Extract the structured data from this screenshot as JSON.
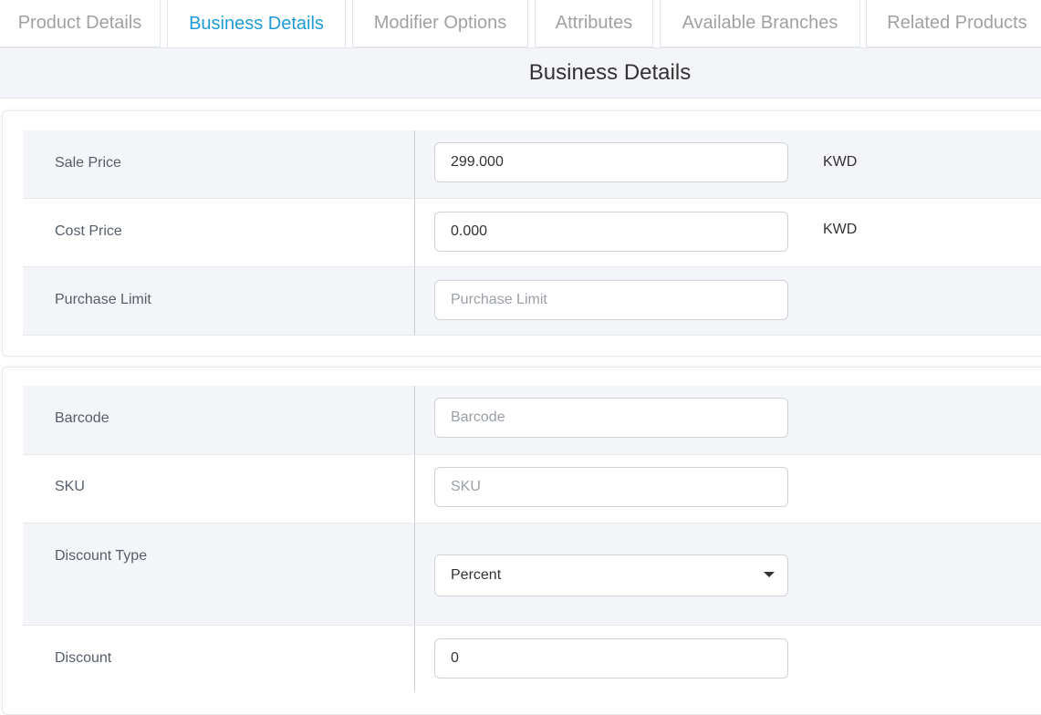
{
  "tabs": [
    {
      "label": "Product Details"
    },
    {
      "label": "Business Details"
    },
    {
      "label": "Modifier Options"
    },
    {
      "label": "Attributes"
    },
    {
      "label": "Available Branches"
    },
    {
      "label": "Related Products"
    }
  ],
  "active_tab": "Business Details",
  "section": {
    "title": "Business Details"
  },
  "card1": {
    "sale_price": {
      "label": "Sale Price",
      "value": "299.000",
      "unit": "KWD"
    },
    "cost_price": {
      "label": "Cost Price",
      "value": "0.000",
      "unit": "KWD"
    },
    "purchase_limit": {
      "label": "Purchase Limit",
      "placeholder": "Purchase Limit"
    }
  },
  "card2": {
    "barcode": {
      "label": "Barcode",
      "placeholder": "Barcode"
    },
    "sku": {
      "label": "SKU",
      "placeholder": "SKU"
    },
    "discount_type": {
      "label": "Discount Type",
      "value": "Percent",
      "icon": "caret-down-icon"
    },
    "discount": {
      "label": "Discount",
      "value": "0"
    }
  },
  "colors": {
    "active_tab": "#1f9ad6",
    "row_shade": "#f4f5f8",
    "border": "#e3e6ea"
  }
}
